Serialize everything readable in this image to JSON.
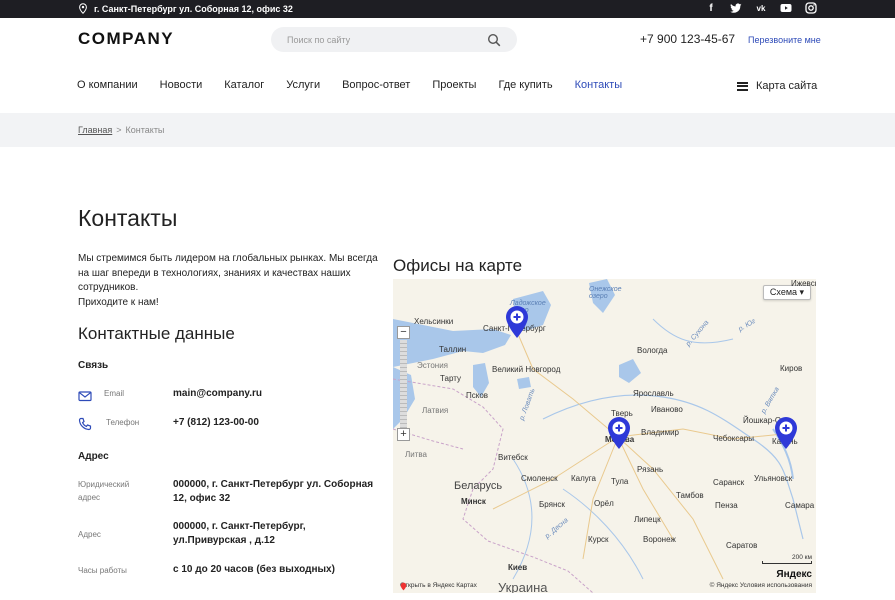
{
  "topbar": {
    "address": "г. Санкт-Петербург ул. Соборная 12, офис 32",
    "socials": [
      {
        "icon": "facebook-icon",
        "glyph": "f"
      },
      {
        "icon": "twitter-icon",
        "glyph": "t"
      },
      {
        "icon": "vk-icon",
        "glyph": "vk"
      },
      {
        "icon": "youtube-icon",
        "glyph": "▶"
      },
      {
        "icon": "instagram-icon",
        "glyph": "◎"
      }
    ]
  },
  "header": {
    "logo": "COMPANY",
    "search_placeholder": "Поиск по сайту",
    "phone": "+7 900 123-45-67",
    "callback": "Перезвоните мне",
    "nav": [
      "О компании",
      "Новости",
      "Каталог",
      "Услуги",
      "Вопрос-ответ",
      "Проекты",
      "Где купить",
      "Контакты"
    ],
    "active_nav": "Контакты",
    "sitemap": "Карта сайта"
  },
  "breadcrumb": {
    "home": "Главная",
    "separator": ">",
    "current": "Контакты"
  },
  "page": {
    "title": "Контакты",
    "intro_line1": "Мы стремимся быть лидером на глобальных рынках. Мы всегда на шаг впереди в технологиях, знаниях и качествах наших сотрудников.",
    "intro_line2": "Приходите к нам!",
    "contacts_heading": "Контактные данные",
    "communication": {
      "heading": "Связь",
      "email_label": "Email",
      "email_value": "main@company.ru",
      "phone_label": "Телефон",
      "phone_value": "+7 (812) 123-00-00"
    },
    "address": {
      "heading": "Адрес",
      "legal_label": "Юридический адрес",
      "legal_value": "000000, г. Санкт-Петербург ул. Соборная 12, офис 32",
      "addr_label": "Адрес",
      "addr_value": "000000, г. Санкт-Петербург, ул.Привурская , д.12",
      "hours_label": "Часы работы",
      "hours_value": "с 10 до 20 часов (без выходных)"
    }
  },
  "map": {
    "title": "Офисы на карте",
    "scheme_button": "Схема",
    "zoom_in": "+",
    "zoom_out": "−",
    "open_link": "Открыть в Яндекс Картах",
    "copyright": "© Яндекс  Условия использования",
    "logo": "Яндекс",
    "scale": "200 км",
    "labels": {
      "helsinki": "Хельсинки",
      "spb": "Санкт-Петербург",
      "tallinn": "Таллин",
      "estonia": "Эстония",
      "tartu": "Тарту",
      "vnovgorod": "Великий Новгород",
      "pskov": "Псков",
      "latvia": "Латвия",
      "litva": "Литва",
      "vitebsk": "Витебск",
      "belarus": "Беларусь",
      "minsk": "Минск",
      "smolensk": "Смоленск",
      "kaluga": "Калуга",
      "tula": "Тула",
      "bryansk": "Брянск",
      "orel": "Орёл",
      "lipetsk": "Липецк",
      "kursk": "Курск",
      "voronezh": "Воронеж",
      "kiev": "Киев",
      "ukraine": "Украина",
      "moscow": "Москва",
      "tver": "Тверь",
      "yaroslavl": "Ярославль",
      "vologda": "Вологда",
      "ivanovo": "Иваново",
      "vladimir": "Владимир",
      "ryazan": "Рязань",
      "cheboksary": "Чебоксары",
      "yoshkarola": "Йошкар-Ола",
      "kazan": "Казань",
      "kirov": "Киров",
      "izhevsk": "Ижевск",
      "ulyanovsk": "Ульяновск",
      "saransk": "Саранск",
      "penza": "Пенза",
      "samara": "Самара",
      "tambov": "Тамбов",
      "saratov": "Саратов",
      "ladoga": "Ладожское озеро",
      "onega": "Онежское озеро",
      "sukhona": "р. Сухона",
      "yug": "р. Юг",
      "vyatka": "р. Вятка",
      "lovat": "р. Ловать",
      "desna": "р. Десна"
    }
  }
}
